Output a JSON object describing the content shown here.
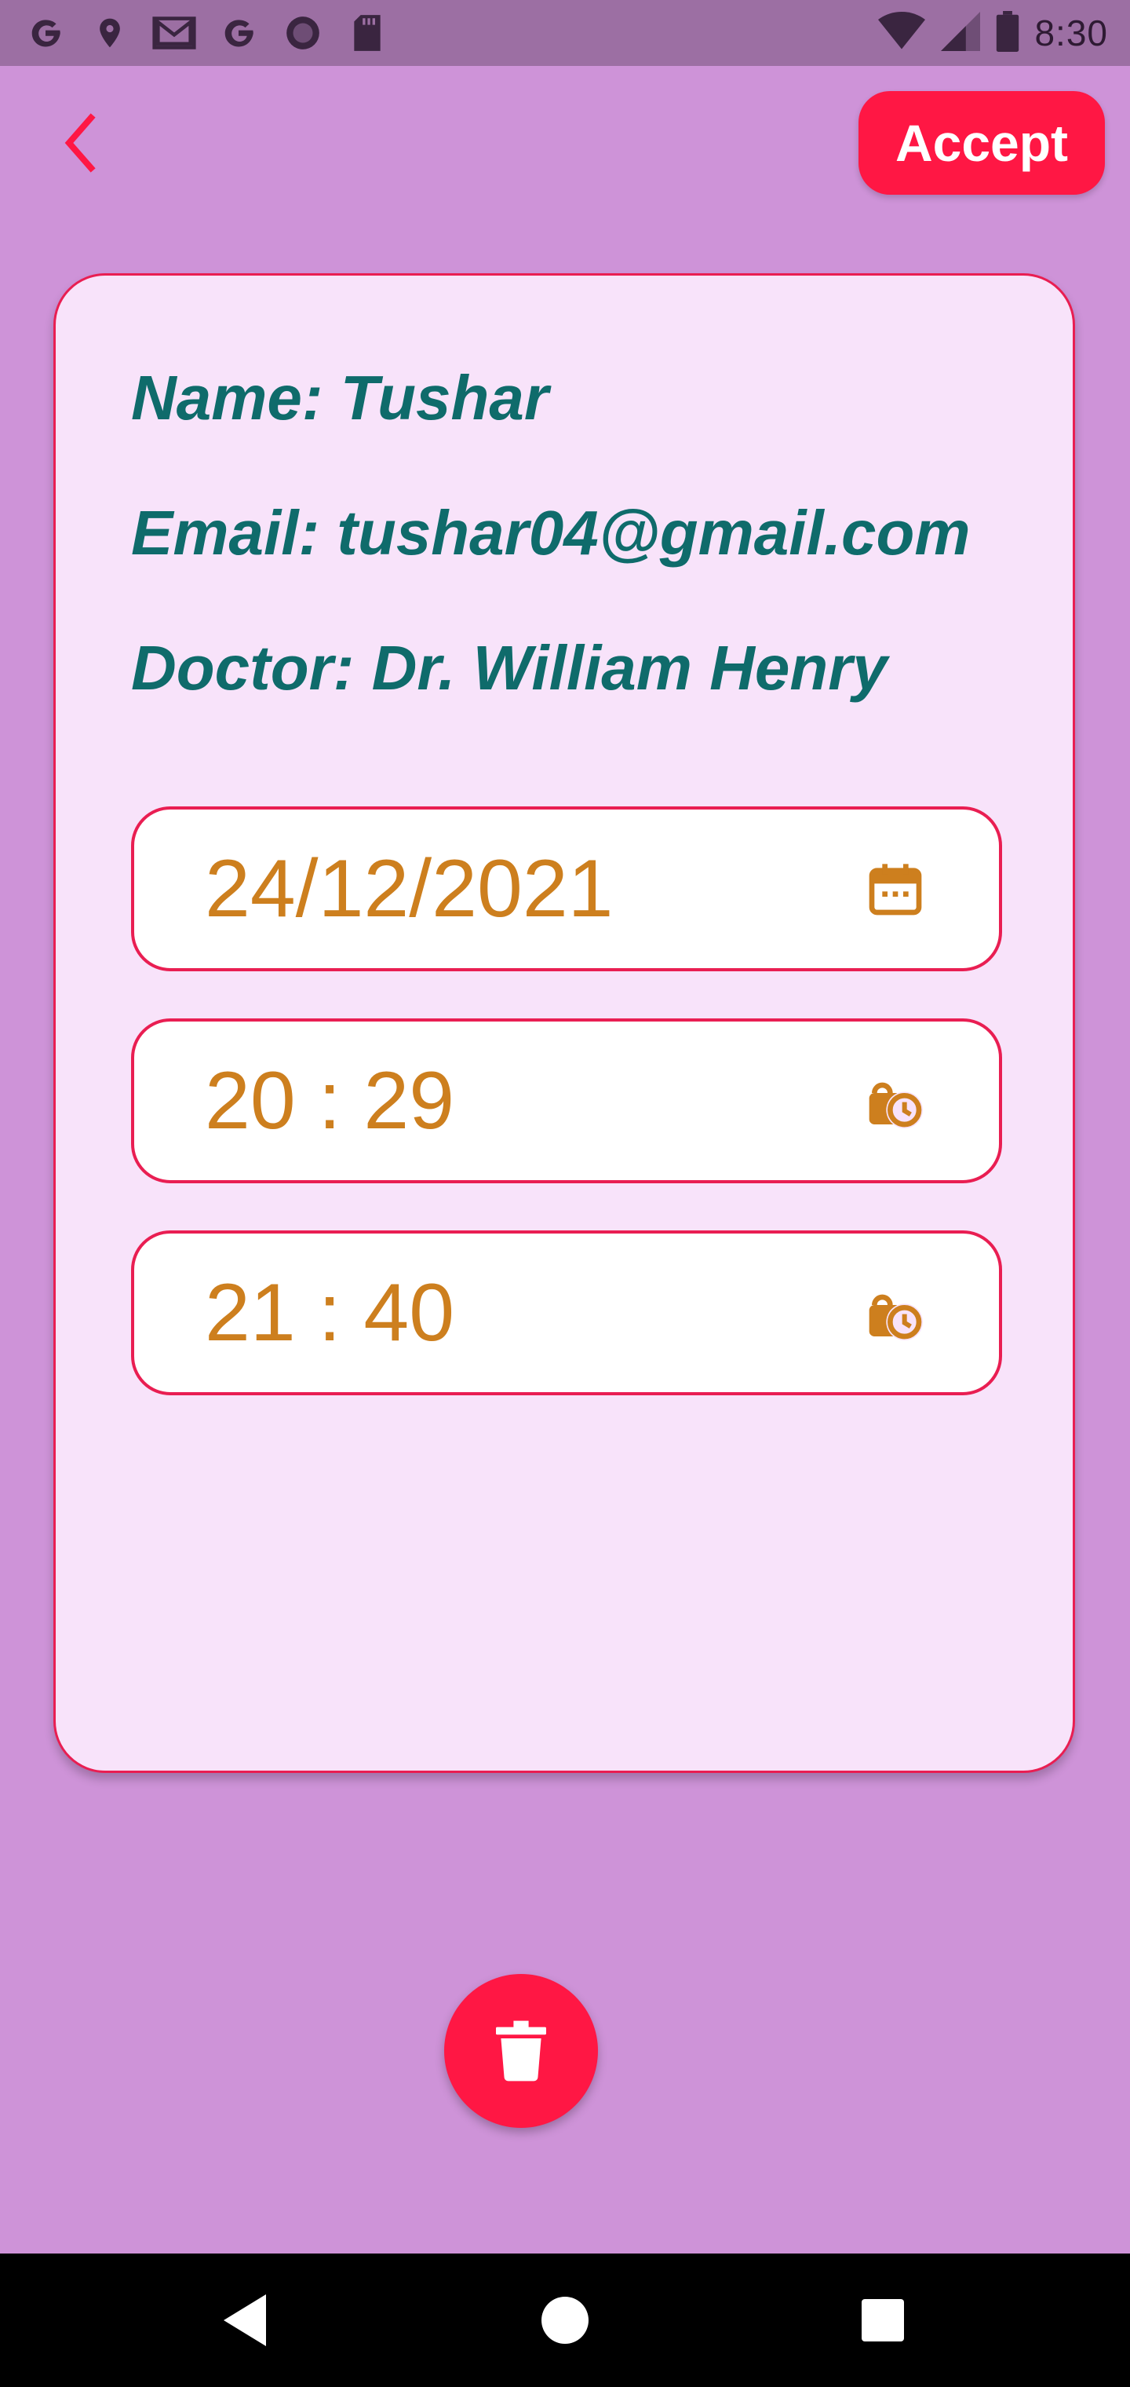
{
  "status_bar": {
    "time": "8:30",
    "left_icons": [
      "google-icon",
      "location-icon",
      "gmail-icon",
      "google-icon",
      "circle-app-icon",
      "sd-card-icon"
    ],
    "right_icons": [
      "wifi-icon",
      "signal-icon",
      "battery-icon"
    ]
  },
  "toolbar": {
    "back_icon": "chevron-left-icon",
    "accept_label": "Accept"
  },
  "card": {
    "name_line": "Name: Tushar",
    "email_line": "Email: tushar04@gmail.com",
    "doctor_line": "Doctor: Dr. William Henry",
    "date": {
      "value": "24/12/2021",
      "icon": "calendar-icon"
    },
    "start_time": {
      "value": "20 : 29",
      "icon": "clock-lock-icon"
    },
    "end_time": {
      "value": "21 : 40",
      "icon": "clock-lock-icon"
    }
  },
  "fab": {
    "icon": "trash-icon"
  },
  "nav": {
    "back_icon": "nav-back-icon",
    "home_icon": "nav-home-icon",
    "recents_icon": "nav-recents-icon"
  },
  "colors": {
    "background": "#ce93d8",
    "status_bar": "#9c6fa3",
    "accent": "#ff1744",
    "card_background": "#f8e3fa",
    "card_border": "#e91e52",
    "info_text": "#0f6b6b",
    "field_text": "#cd7f1e"
  }
}
